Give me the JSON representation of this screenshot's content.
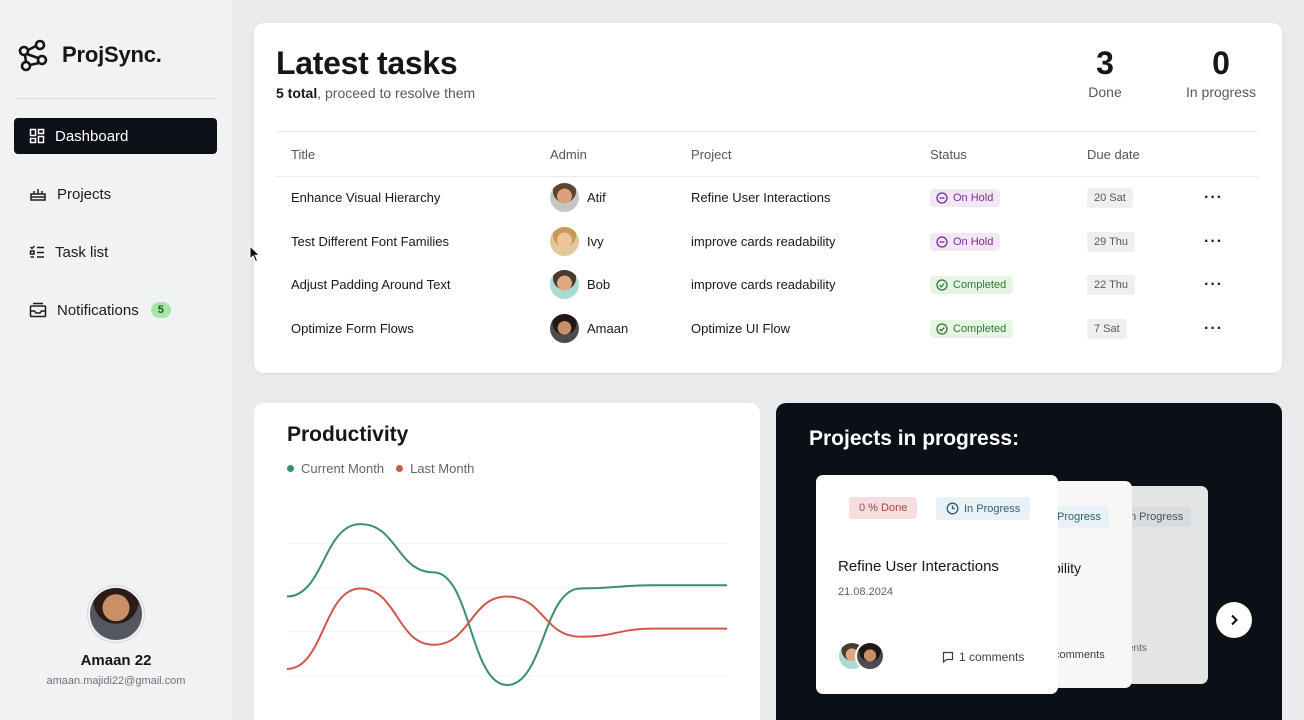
{
  "brand": {
    "name": "ProjSync."
  },
  "sidebar": {
    "items": [
      {
        "label": "Dashboard",
        "icon": "dashboard-icon",
        "active": true
      },
      {
        "label": "Projects",
        "icon": "projects-icon"
      },
      {
        "label": "Task list",
        "icon": "task-list-icon"
      },
      {
        "label": "Notifications",
        "icon": "inbox-icon",
        "badge": "5"
      }
    ],
    "profile": {
      "name": "Amaan 22",
      "email": "amaan.majidi22@gmail.com"
    }
  },
  "tasks": {
    "title": "Latest tasks",
    "total_bold": "5 total",
    "subtitle_rest": ", proceed to resolve them",
    "stats": [
      {
        "value": "3",
        "label": "Done"
      },
      {
        "value": "0",
        "label": "In progress"
      }
    ],
    "columns": [
      "Title",
      "Admin",
      "Project",
      "Status",
      "Due date"
    ],
    "rows": [
      {
        "title": "Enhance Visual Hierarchy",
        "admin": "Atif",
        "project": "Refine User Interactions",
        "status": "On Hold",
        "due": "20 Sat"
      },
      {
        "title": "Test Different Font Families",
        "admin": "Ivy",
        "project": "improve cards readability",
        "status": "On Hold",
        "due": "29 Thu"
      },
      {
        "title": "Adjust Padding Around Text",
        "admin": "Bob",
        "project": "improve cards readability",
        "status": "Completed",
        "due": "22 Thu"
      },
      {
        "title": "Optimize Form Flows",
        "admin": "Amaan",
        "project": "Optimize UI Flow",
        "status": "Completed",
        "due": "7 Sat"
      }
    ],
    "more": "···"
  },
  "productivity": {
    "title": "Productivity",
    "legend": [
      {
        "label": "Current Month",
        "color": "#3a8f73"
      },
      {
        "label": "Last Month",
        "color": "#d1564b"
      }
    ]
  },
  "chart_data": {
    "type": "line",
    "title": "Productivity",
    "x": [
      0,
      1,
      2,
      3,
      4,
      5,
      6
    ],
    "series": [
      {
        "name": "Current Month",
        "color": "#3a8f73",
        "values": [
          45,
          90,
          60,
          -10,
          50,
          52,
          52
        ]
      },
      {
        "name": "Last Month",
        "color": "#d1564b",
        "values": [
          0,
          50,
          15,
          45,
          20,
          25,
          25
        ]
      }
    ],
    "ylim": [
      -10,
      100
    ],
    "grid": true
  },
  "projects": {
    "title": "Projects in progress:",
    "front": {
      "done": "0 % Done",
      "status": "In Progress",
      "name": "Refine User Interactions",
      "date": "21.08.2024",
      "comments": "1 comments"
    },
    "back1": {
      "status": "Progress",
      "name": "bility",
      "comments": "comments"
    },
    "back2": {
      "status": "n Progress",
      "comments": "ents"
    }
  },
  "colors": {
    "accent_dark": "#0d1117",
    "on_hold": "#7a2d97",
    "completed": "#2e7a34",
    "current_month": "#3a8f73",
    "last_month": "#d1564b"
  }
}
